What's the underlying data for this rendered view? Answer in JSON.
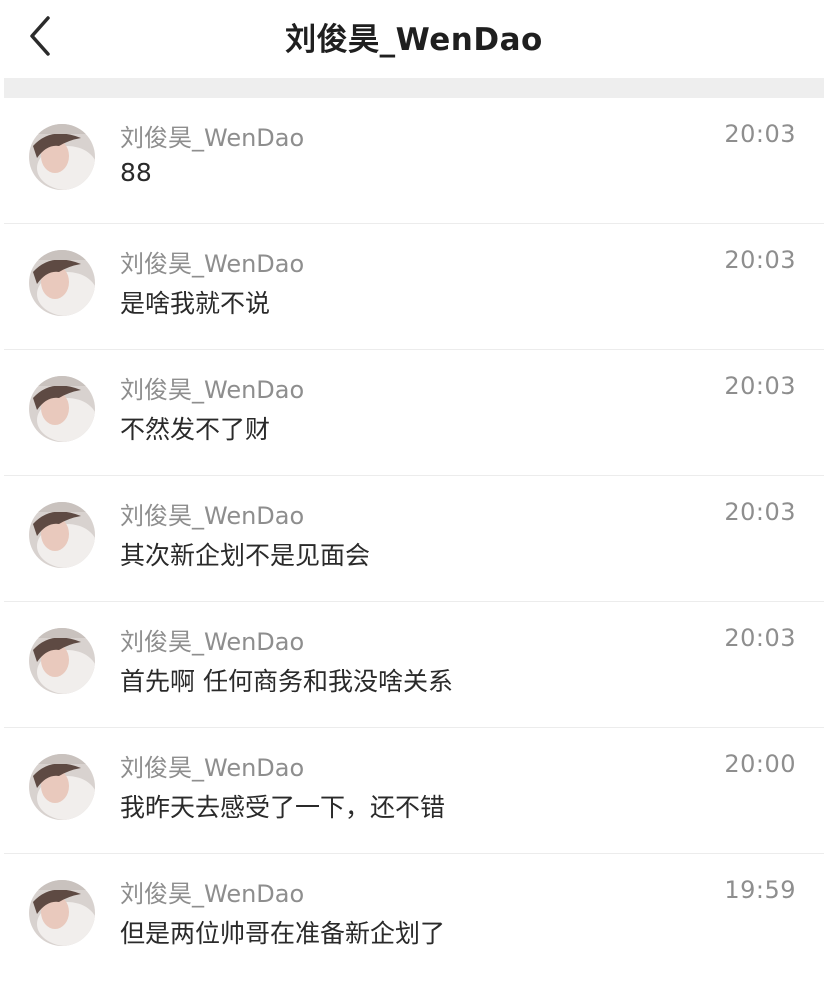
{
  "header": {
    "title": "刘俊昊_WenDao"
  },
  "messages": [
    {
      "sender": "刘俊昊_WenDao",
      "text": "88",
      "time": "20:03"
    },
    {
      "sender": "刘俊昊_WenDao",
      "text": "是啥我就不说",
      "time": "20:03"
    },
    {
      "sender": "刘俊昊_WenDao",
      "text": "不然发不了财",
      "time": "20:03"
    },
    {
      "sender": "刘俊昊_WenDao",
      "text": "其次新企划不是见面会",
      "time": "20:03"
    },
    {
      "sender": "刘俊昊_WenDao",
      "text": "首先啊 任何商务和我没啥关系",
      "time": "20:03"
    },
    {
      "sender": "刘俊昊_WenDao",
      "text": "我昨天去感受了一下，还不错",
      "time": "20:00"
    },
    {
      "sender": "刘俊昊_WenDao",
      "text": "但是两位帅哥在准备新企划了",
      "time": "19:59"
    }
  ],
  "icons": {
    "back": "chevron-left-icon",
    "avatar": "avatar-photo"
  },
  "colors": {
    "title": "#1f1f1f",
    "secondary_text": "#8e8e8e",
    "divider": "#ececec",
    "band": "#eeeeee"
  }
}
